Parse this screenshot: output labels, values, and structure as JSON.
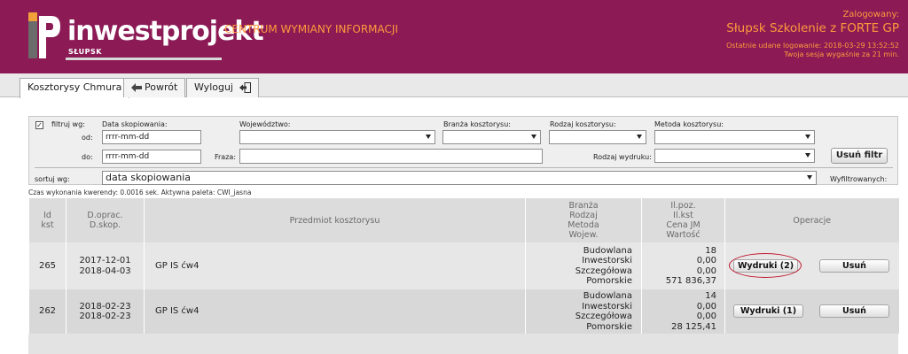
{
  "header": {
    "logo_text": "inwestprojekt",
    "logo_city": "SŁUPSK",
    "center_title": "CENTRUM WYMIANY INFORMACJI",
    "user_label": "Zalogowany:",
    "user_name": "Słupsk Szkolenie z FORTE GP",
    "last_login": "Ostatnie udane logowanie: 2018-03-29 13:52:52",
    "session": "Twoja sesja wygaśnie za 21 min."
  },
  "tabs": {
    "tab1": "Kosztorysy Chmura",
    "tab2": "Powrót",
    "tab3": "Wyloguj"
  },
  "filter": {
    "filter_label": "filtruj wg:",
    "date_label": "Data skopiowania:",
    "from_label": "od:",
    "to_label": "do:",
    "from_placeholder": "rrrr-mm-dd",
    "to_placeholder": "rrrr-mm-dd",
    "voivodeship_label": "Województwo:",
    "branch_label": "Branża kosztorysu:",
    "type_label": "Rodzaj kosztorysu:",
    "method_label": "Metoda kosztorysu:",
    "phrase_label": "Fraza:",
    "print_type_label": "Rodzaj wydruku:",
    "clear_button": "Usuń filtr",
    "sort_label": "sortuj wg:",
    "sort_value": "data skopiowania",
    "filtered_label": "Wyfiltrowanych:"
  },
  "stats": "Czas wykonania kwerendy: 0.0016 sek.   Aktywna paleta: CWI_jasna",
  "table": {
    "headers": {
      "id": [
        "Id",
        "kst"
      ],
      "dates": [
        "D.oprac.",
        "D.skop."
      ],
      "subject": "Przedmiot kosztorysu",
      "branch": [
        "Branża",
        "Rodzaj",
        "Metoda",
        "Wojew."
      ],
      "values": [
        "Il.poz.",
        "Il.kst",
        "Cena JM",
        "Wartość"
      ],
      "ops": "Operacje"
    },
    "rows": [
      {
        "id": "265",
        "date_prep": "2017-12-01",
        "date_copy": "2018-04-03",
        "subject": "GP IS ćw4",
        "branch": [
          "Budowlana",
          "Inwestorski",
          "Szczegółowa",
          "Pomorskie"
        ],
        "values": [
          "18",
          "0,00",
          "0,00",
          "571 836,37"
        ],
        "print_button": "Wydruki (2)",
        "delete_button": "Usuń"
      },
      {
        "id": "262",
        "date_prep": "2018-02-23",
        "date_copy": "2018-02-23",
        "subject": "GP IS ćw4",
        "branch": [
          "Budowlana",
          "Inwestorski",
          "Szczegółowa",
          "Pomorskie"
        ],
        "values": [
          "14",
          "0,00",
          "0,00",
          "28 125,41"
        ],
        "print_button": "Wydruki (1)",
        "delete_button": "Usuń"
      }
    ]
  },
  "colors": {
    "header_bg": "#8b1a55",
    "header_text": "#ff9a3c",
    "highlight_ring": "#c0182c"
  }
}
